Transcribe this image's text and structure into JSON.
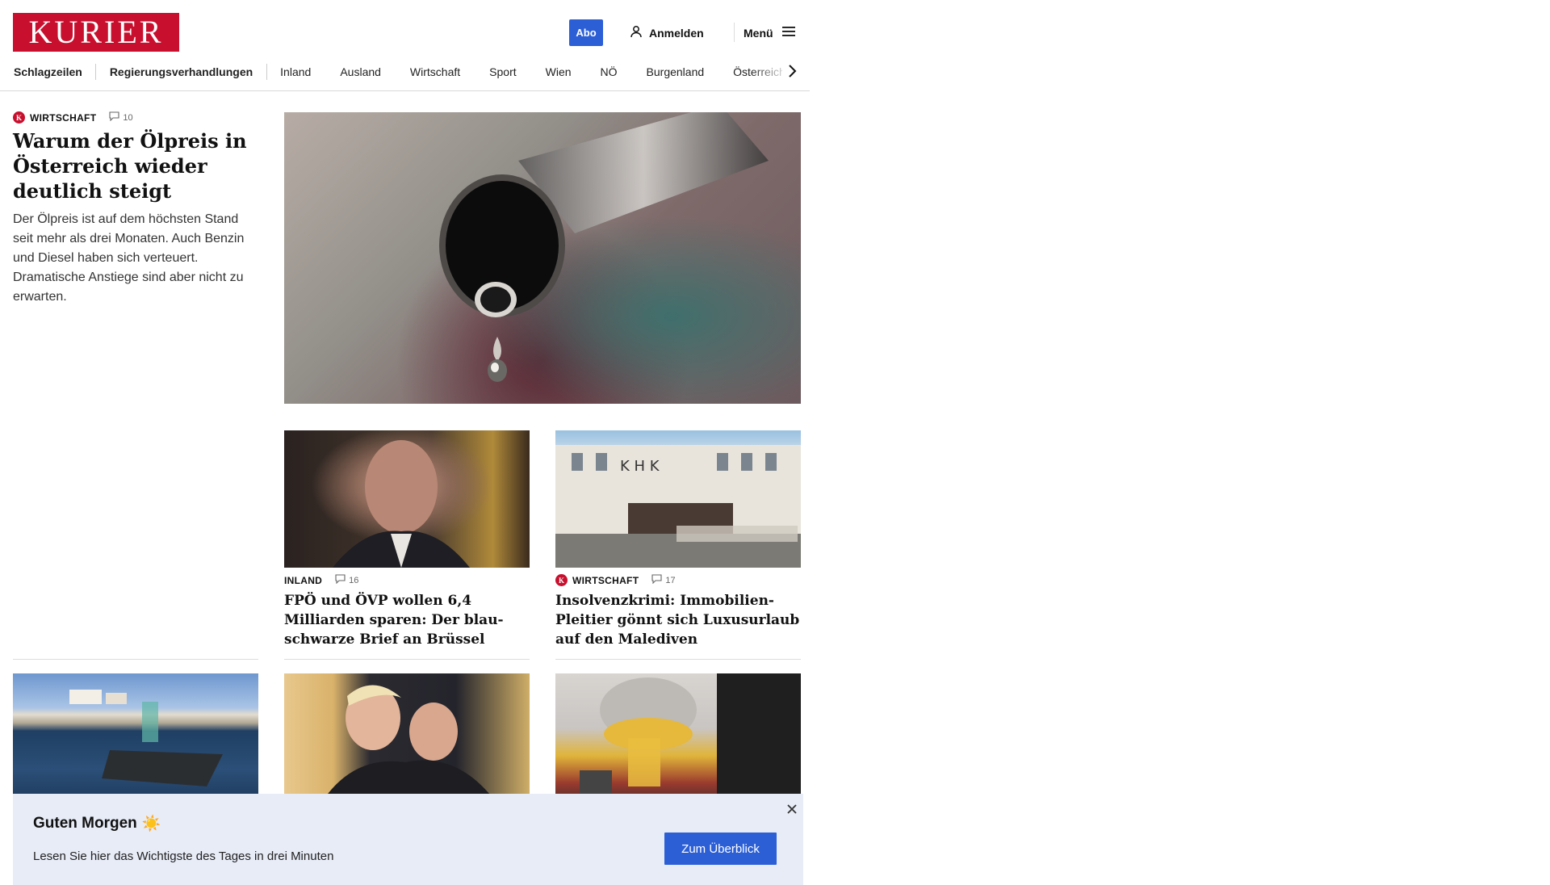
{
  "header": {
    "logo": "KURIER",
    "abo_label": "Abo",
    "login_label": "Anmelden",
    "menu_label": "Menü"
  },
  "nav": {
    "items": [
      "Schlagzeilen",
      "Regierungsverhandlungen",
      "Inland",
      "Ausland",
      "Wirtschaft",
      "Sport",
      "Wien",
      "NÖ",
      "Burgenland",
      "Österreich"
    ]
  },
  "lead": {
    "badge": "K",
    "category": "WIRTSCHAFT",
    "comments": "10",
    "title": "Warum der Ölpreis in Ös­terreich wieder deutlich steigt",
    "teaser": "Der Ölpreis ist auf dem höchsten Stand seit mehr als drei Monaten. Auch Benzin und Diesel haben sich verteuert. Dramatische Anstiege sind aber nicht zu erwarten.",
    "image": "fuel-nozzle-drop"
  },
  "cards": [
    {
      "category": "INLAND",
      "comments": "16",
      "title": "FPÖ und ÖVP wollen 6,4 Milliarden sparen: Der blau-schwarze Brief an Brüssel",
      "image": "politician-portrait"
    },
    {
      "badge": "K",
      "category": "WIRTSCHAFT",
      "comments": "17",
      "title": "Insolvenzkrimi: Immobilien-Plei­tier gönnt sich Luxusurlaub auf den Malediven",
      "image": "white-building-facade"
    }
  ],
  "row2_images": [
    "lake-houses",
    "two-men-hug",
    "pouring-liquid"
  ],
  "banner": {
    "title": "Guten Morgen",
    "emoji": "☀️",
    "subtitle": "Lesen Sie hier das Wichtigste des Tages in drei Minuten",
    "button_label": "Zum Überblick"
  },
  "colors": {
    "brand_red": "#c8102e",
    "accent_blue": "#2c5fd6",
    "banner_bg": "#e7ecf7"
  }
}
